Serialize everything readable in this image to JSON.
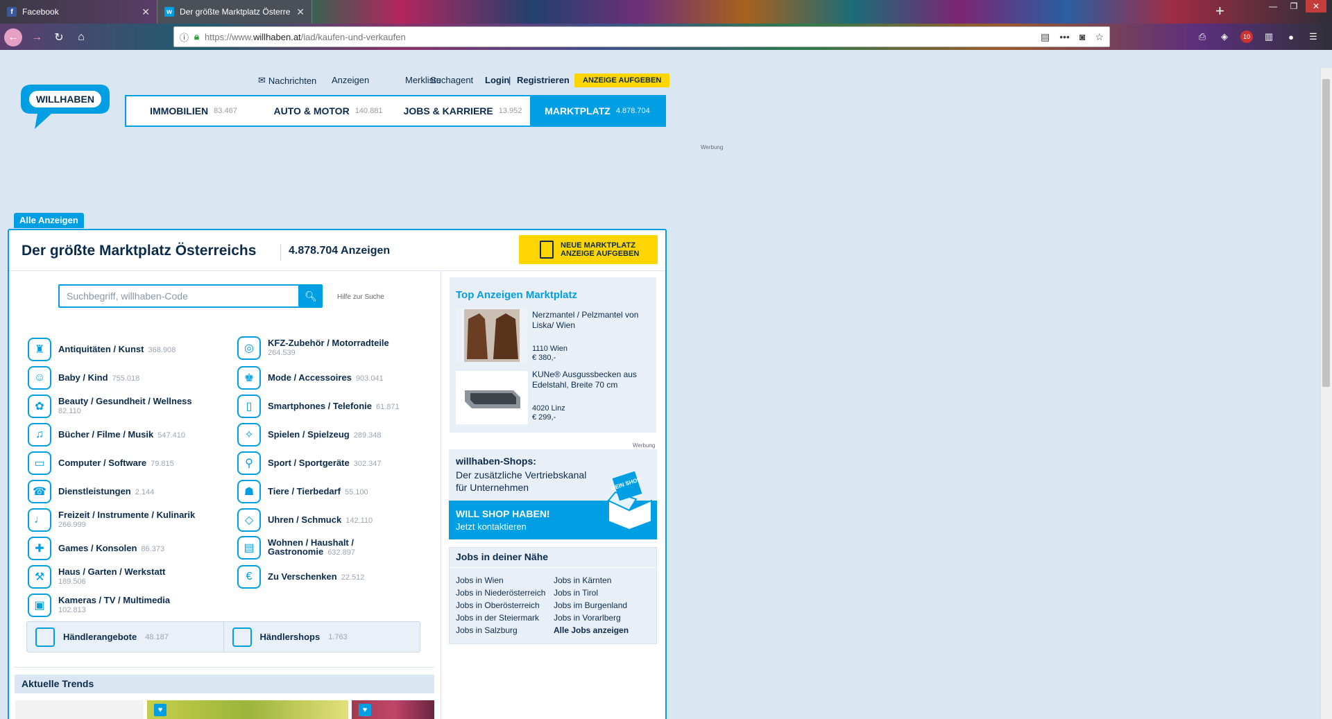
{
  "browser": {
    "tabs": [
      {
        "label": "Facebook",
        "icon": "facebook-icon"
      },
      {
        "label": "Der größte Marktplatz Österreichs",
        "icon": "willhaben-favicon"
      }
    ],
    "url_prefix": "https://www.",
    "url_domain": "willhaben.at",
    "url_path": "/iad/kaufen-und-verkaufen",
    "addon_badge": "10"
  },
  "header": {
    "logo_text": "WILLHABEN",
    "nav": {
      "nachrichten": "Nachrichten",
      "anzeigen": "Anzeigen",
      "merkliste": "Merkliste",
      "suchagent": "Suchagent",
      "login": "Login",
      "sep": "|",
      "registrieren": "Registrieren",
      "anzeige_aufgeben": "ANZEIGE AUFGEBEN"
    },
    "verticals": [
      {
        "label": "IMMOBILIEN",
        "count": "83.467"
      },
      {
        "label": "AUTO & MOTOR",
        "count": "140.881"
      },
      {
        "label": "JOBS & KARRIERE",
        "count": "13.952"
      },
      {
        "label": "MARKTPLATZ",
        "count": "4.878.704"
      }
    ],
    "werbung": "Werbung"
  },
  "main": {
    "tab_label": "Alle Anzeigen",
    "title": "Der größte Marktplatz Österreichs",
    "count": "4.878.704 Anzeigen",
    "new_ad_line1": "NEUE MARKTPLATZ",
    "new_ad_line2": "ANZEIGE AUFGEBEN",
    "search_placeholder": "Suchbegriff, willhaben-Code",
    "search_help": "Hilfe zur Suche",
    "categories_left": [
      {
        "label": "Antiquitäten / Kunst",
        "count": "368.908",
        "icon": "easel-icon",
        "glyph": "♜"
      },
      {
        "label": "Baby / Kind",
        "count": "755.018",
        "icon": "baby-icon",
        "glyph": "☺"
      },
      {
        "label": "Beauty / Gesundheit / Wellness",
        "count": "82.110",
        "icon": "beauty-icon",
        "glyph": "✿"
      },
      {
        "label": "Bücher / Filme / Musik",
        "count": "547.410",
        "icon": "books-icon",
        "glyph": "♫"
      },
      {
        "label": "Computer / Software",
        "count": "79.815",
        "icon": "laptop-icon",
        "glyph": "▭"
      },
      {
        "label": "Dienstleistungen",
        "count": "2.144",
        "icon": "service-icon",
        "glyph": "☎"
      },
      {
        "label": "Freizeit / Instrumente / Kulinarik",
        "count": "266.999",
        "icon": "drum-icon",
        "glyph": "♩"
      },
      {
        "label": "Games / Konsolen",
        "count": "86.373",
        "icon": "gamepad-icon",
        "glyph": "✚"
      },
      {
        "label": "Haus / Garten / Werkstatt",
        "count": "189.506",
        "icon": "wheelbarrow-icon",
        "glyph": "⚒"
      },
      {
        "label": "Kameras / TV / Multimedia",
        "count": "102.813",
        "icon": "tv-icon",
        "glyph": "▣"
      }
    ],
    "categories_right": [
      {
        "label": "KFZ-Zubehör / Motorradteile",
        "count": "264.539",
        "icon": "tire-icon",
        "glyph": "◎"
      },
      {
        "label": "Mode / Accessoires",
        "count": "903.041",
        "icon": "shirt-icon",
        "glyph": "♚"
      },
      {
        "label": "Smartphones / Telefonie",
        "count": "61.871",
        "icon": "smartphone-icon",
        "glyph": "▯"
      },
      {
        "label": "Spielen / Spielzeug",
        "count": "289.348",
        "icon": "puzzle-icon",
        "glyph": "✧"
      },
      {
        "label": "Sport / Sportgeräte",
        "count": "302.347",
        "icon": "racket-icon",
        "glyph": "⚲"
      },
      {
        "label": "Tiere / Tierbedarf",
        "count": "55.100",
        "icon": "cat-icon",
        "glyph": "☗"
      },
      {
        "label": "Uhren / Schmuck",
        "count": "142.110",
        "icon": "ring-icon",
        "glyph": "◇"
      },
      {
        "label": "Wohnen / Haushalt / Gastronomie",
        "count": "632.897",
        "icon": "furniture-icon",
        "glyph": "▤"
      },
      {
        "label": "Zu Verschenken",
        "count": "22.512",
        "icon": "gift-icon",
        "glyph": "€"
      }
    ],
    "haendler": [
      {
        "label": "Händlerangebote",
        "count": "48.187",
        "icon": "list-icon"
      },
      {
        "label": "Händlershops",
        "count": "1.763",
        "icon": "shop-box-icon"
      }
    ],
    "trends_title": "Aktuelle Trends"
  },
  "sidebar": {
    "top_title": "Top Anzeigen Marktplatz",
    "top_ads": [
      {
        "title": "Nerzmantel / Pelzmantel von Liska/ Wien",
        "location": "1110 Wien",
        "price": "€ 380,-",
        "icon": "fur-coat-image"
      },
      {
        "title": "KUNe® Ausgussbecken aus Edelstahl, Breite 70 cm",
        "location": "4020 Linz",
        "price": "€ 299,-",
        "icon": "steel-sink-image"
      }
    ],
    "werbung": "Werbung",
    "shops_title": "willhaben-Shops:",
    "shops_sub": "Der zusätzliche Vertriebskanal für Unternehmen",
    "shops_cta1": "WILL SHOP HABEN!",
    "shops_cta2": "Jetzt kontaktieren",
    "shop_box_text": "MEIN SHOP",
    "jobs_title": "Jobs in deiner Nähe",
    "jobs_left": [
      "Jobs in Wien",
      "Jobs in Niederösterreich",
      "Jobs in Oberösterreich",
      "Jobs in der Steiermark",
      "Jobs in Salzburg"
    ],
    "jobs_right": [
      "Jobs in Kärnten",
      "Jobs in Tirol",
      "Jobs im Burgenland",
      "Jobs in Vorarlberg",
      "Alle Jobs anzeigen"
    ]
  }
}
